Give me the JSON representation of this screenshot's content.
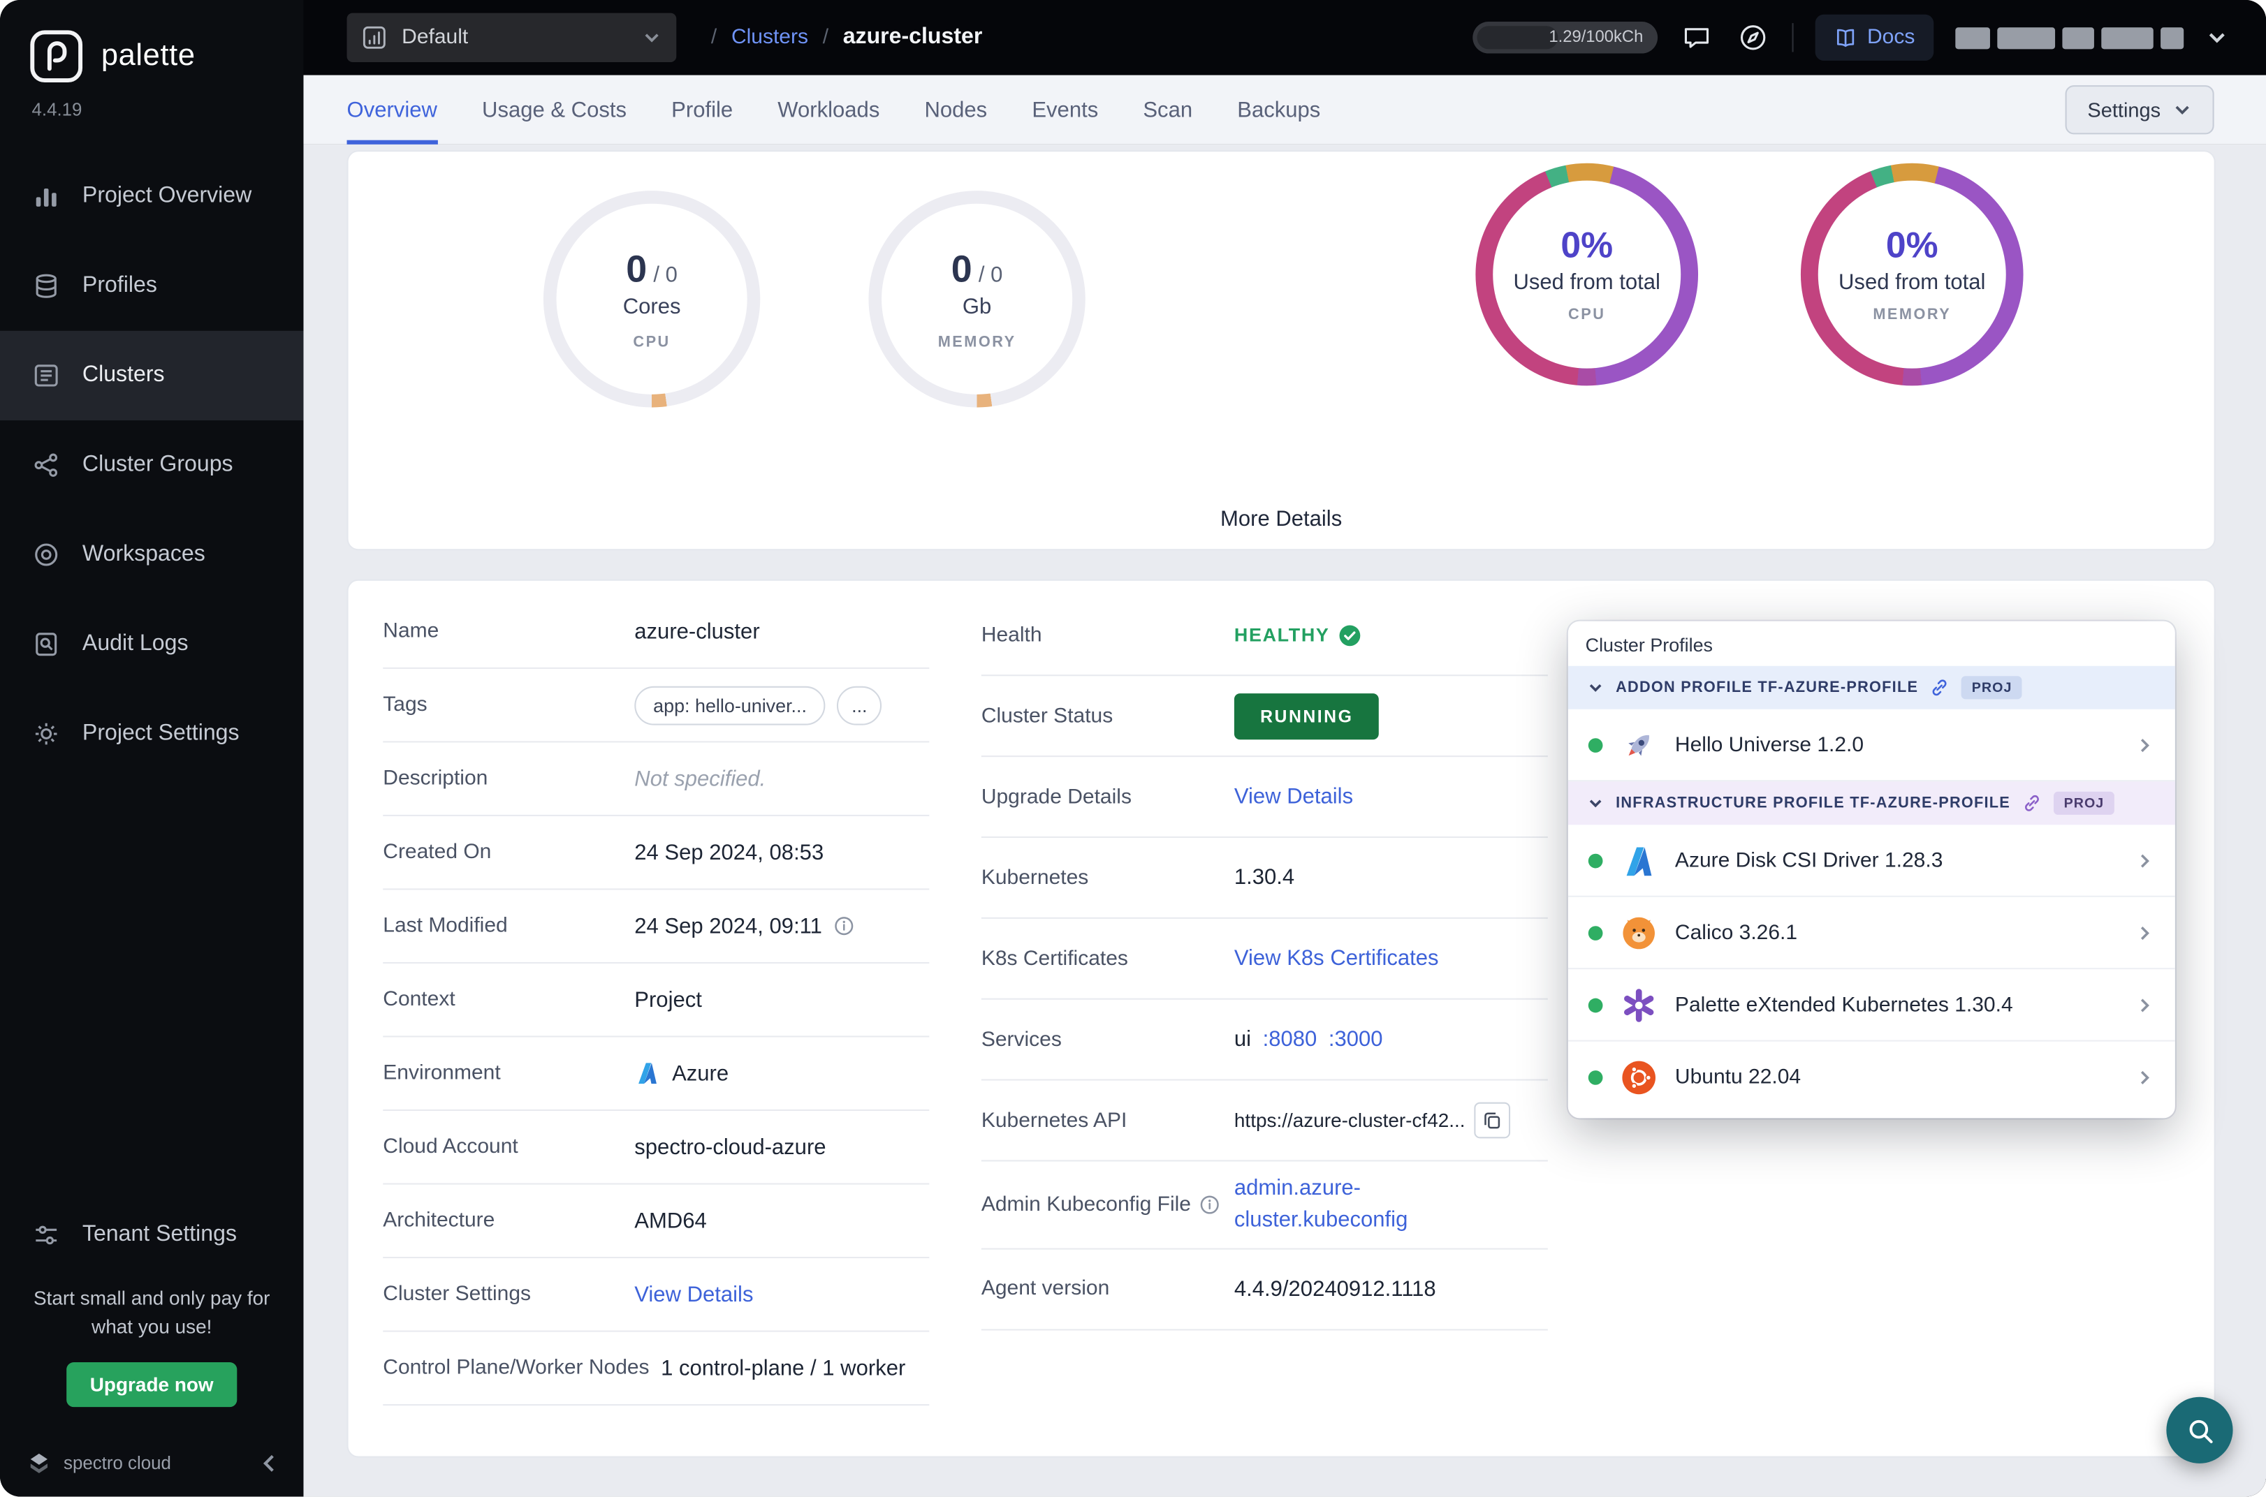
{
  "sidebar": {
    "brand": "palette",
    "version": "4.4.19",
    "items": [
      {
        "label": "Project Overview",
        "icon": "bar-chart-icon"
      },
      {
        "label": "Profiles",
        "icon": "layers-icon"
      },
      {
        "label": "Clusters",
        "icon": "cluster-list-icon",
        "active": true
      },
      {
        "label": "Cluster Groups",
        "icon": "node-graph-icon"
      },
      {
        "label": "Workspaces",
        "icon": "target-icon"
      },
      {
        "label": "Audit Logs",
        "icon": "audit-log-icon"
      },
      {
        "label": "Project Settings",
        "icon": "gear-icon"
      }
    ],
    "tenant_settings_label": "Tenant Settings",
    "promo_text": "Start small and only pay for what you use!",
    "upgrade_button": "Upgrade now",
    "footer_brand": "spectro cloud"
  },
  "header": {
    "project_selector": "Default",
    "breadcrumb": {
      "separator": "/",
      "root": "Clusters",
      "current": "azure-cluster"
    },
    "usage_meter": "1.29/100kCh",
    "docs_label": "Docs"
  },
  "tabs": {
    "items": [
      "Overview",
      "Usage & Costs",
      "Profile",
      "Workloads",
      "Nodes",
      "Events",
      "Scan",
      "Backups"
    ],
    "active": "Overview",
    "settings_button": "Settings"
  },
  "metrics": {
    "cpu_gauge": {
      "value": "0",
      "total": "/ 0",
      "unit": "Cores",
      "caption": "CPU"
    },
    "memory_gauge": {
      "value": "0",
      "total": "/ 0",
      "unit": "Gb",
      "caption": "MEMORY"
    },
    "cpu_donut": {
      "percent": "0%",
      "label": "Used from total",
      "caption": "CPU"
    },
    "memory_donut": {
      "percent": "0%",
      "label": "Used from total",
      "caption": "MEMORY"
    },
    "more_details_label": "More Details"
  },
  "details": {
    "name": {
      "label": "Name",
      "value": "azure-cluster"
    },
    "tags": {
      "label": "Tags",
      "chip": "app: hello-univer...",
      "more_chip": "..."
    },
    "description": {
      "label": "Description",
      "value": "Not specified."
    },
    "created_on": {
      "label": "Created On",
      "value": "24 Sep 2024, 08:53"
    },
    "last_modified": {
      "label": "Last Modified",
      "value": "24 Sep 2024, 09:11"
    },
    "context": {
      "label": "Context",
      "value": "Project"
    },
    "environment": {
      "label": "Environment",
      "value": "Azure"
    },
    "cloud_account": {
      "label": "Cloud Account",
      "value": "spectro-cloud-azure"
    },
    "architecture": {
      "label": "Architecture",
      "value": "AMD64"
    },
    "cluster_settings": {
      "label": "Cluster Settings",
      "link": "View Details"
    },
    "nodes": {
      "label": "Control Plane/Worker Nodes",
      "value": "1 control-plane / 1 worker"
    },
    "health": {
      "label": "Health",
      "value": "HEALTHY"
    },
    "cluster_status": {
      "label": "Cluster Status",
      "value": "RUNNING"
    },
    "upgrade_details": {
      "label": "Upgrade Details",
      "link": "View Details"
    },
    "kubernetes": {
      "label": "Kubernetes",
      "value": "1.30.4"
    },
    "k8s_certificates": {
      "label": "K8s Certificates",
      "link": "View K8s Certificates"
    },
    "services": {
      "label": "Services",
      "prefix": "ui",
      "ports": [
        ":8080",
        ":3000"
      ]
    },
    "kubernetes_api": {
      "label": "Kubernetes API",
      "value": "https://azure-cluster-cf42..."
    },
    "kubeconfig": {
      "label": "Admin Kubeconfig File",
      "link": "admin.azure-cluster.kubeconfig"
    },
    "agent_version": {
      "label": "Agent version",
      "value": "4.4.9/20240912.1118"
    }
  },
  "cluster_profiles": {
    "title": "Cluster Profiles",
    "sections": [
      {
        "header": "ADDON PROFILE TF-AZURE-PROFILE",
        "badge": "PROJ",
        "items": [
          {
            "name": "Hello Universe 1.2.0",
            "icon": "rocket-icon"
          }
        ]
      },
      {
        "header": "INFRASTRUCTURE PROFILE TF-AZURE-PROFILE",
        "badge": "PROJ",
        "items": [
          {
            "name": "Azure Disk CSI Driver 1.28.3",
            "icon": "azure-icon"
          },
          {
            "name": "Calico 3.26.1",
            "icon": "calico-icon"
          },
          {
            "name": "Palette eXtended Kubernetes 1.30.4",
            "icon": "palette-k8s-icon"
          },
          {
            "name": "Ubuntu 22.04",
            "icon": "ubuntu-icon"
          }
        ]
      }
    ]
  },
  "colors": {
    "accent_blue": "#3f63db",
    "link_blue": "#3d62d9",
    "healthy_green": "#23a061",
    "running_green": "#17753f",
    "upgrade_green": "#27a25d",
    "donut_purple": "#9a55c4",
    "donut_magenta": "#c2437f",
    "donut_orange": "#d79b3e",
    "donut_green": "#43b184",
    "fab_teal": "#1a6a75"
  }
}
